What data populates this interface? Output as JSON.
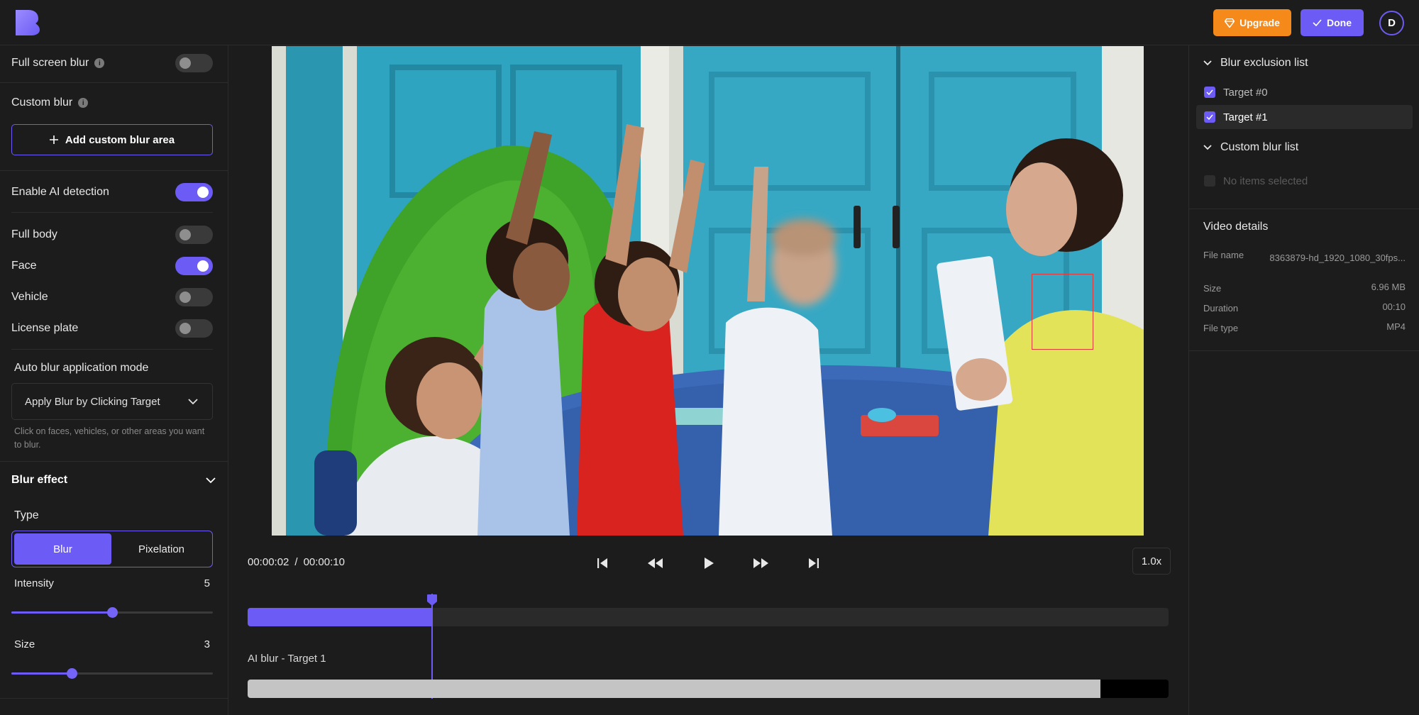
{
  "header": {
    "upgrade_label": "Upgrade",
    "done_label": "Done",
    "avatar_initial": "D"
  },
  "left_panel": {
    "full_screen_blur": {
      "label": "Full screen blur",
      "enabled": false
    },
    "custom_blur": {
      "label": "Custom blur",
      "add_button_label": "Add custom blur area"
    },
    "ai_detection": {
      "label": "Enable AI detection",
      "enabled": true
    },
    "detect_options": [
      {
        "label": "Full body",
        "enabled": false
      },
      {
        "label": "Face",
        "enabled": true
      },
      {
        "label": "Vehicle",
        "enabled": false
      },
      {
        "label": "License plate",
        "enabled": false
      }
    ],
    "auto_blur_mode": {
      "title": "Auto blur application mode",
      "selected": "Apply Blur by Clicking Target",
      "hint": "Click on faces, vehicles, or other areas you want to blur."
    },
    "blur_effect": {
      "title": "Blur effect",
      "type_label": "Type",
      "types": [
        "Blur",
        "Pixelation"
      ],
      "selected_type": "Blur",
      "intensity": {
        "label": "Intensity",
        "value": "5",
        "fraction": 0.5
      },
      "size": {
        "label": "Size",
        "value": "3",
        "fraction": 0.3
      }
    }
  },
  "player": {
    "current_time": "00:00:02",
    "separator": "/",
    "total_time": "00:00:10",
    "speed": "1.0x",
    "progress_fraction": 0.2,
    "layer_label": "AI blur - Target 1",
    "layer_fill_fraction": 0.926
  },
  "right_panel": {
    "exclusion_list": {
      "title": "Blur exclusion list",
      "items": [
        {
          "label": "Target #0",
          "checked": true
        },
        {
          "label": "Target #1",
          "checked": true
        }
      ]
    },
    "custom_blur_list": {
      "title": "Custom blur list",
      "empty_label": "No items selected"
    },
    "video_details": {
      "title": "Video details",
      "rows": [
        {
          "key": "File name",
          "value": "8363879-hd_1920_1080_30fps..."
        },
        {
          "key": "Size",
          "value": "6.96 MB"
        },
        {
          "key": "Duration",
          "value": "00:10"
        },
        {
          "key": "File type",
          "value": "MP4"
        }
      ]
    }
  },
  "colors": {
    "accent": "#6c5bf5",
    "upgrade": "#f5891a",
    "background": "#1c1c1c",
    "target_box": "#e23a3a"
  },
  "icons": [
    "logo-icon",
    "diamond-icon",
    "check-icon",
    "info-icon",
    "plus-icon",
    "chevron-down-icon",
    "skip-start-icon",
    "rewind-icon",
    "play-icon",
    "fast-forward-icon",
    "skip-end-icon"
  ]
}
